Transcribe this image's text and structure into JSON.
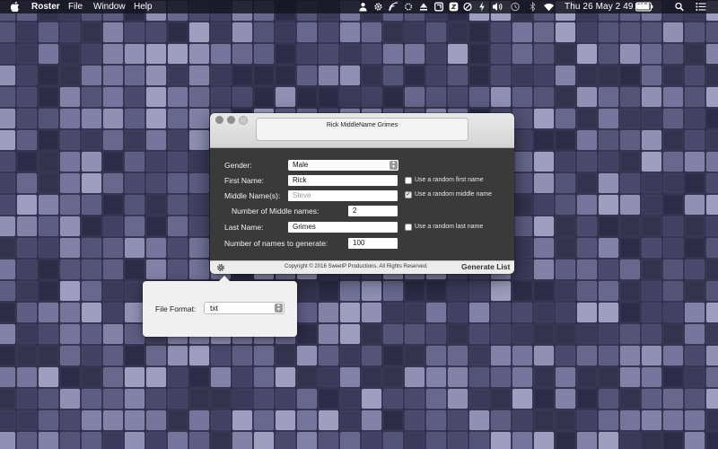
{
  "menubar": {
    "app_name": "Roster",
    "menus": [
      "File",
      "Window",
      "Help"
    ],
    "clock": "Thu 26 May  2 49 PM",
    "status_icons": [
      "user-icon",
      "gear-icon",
      "wifi-cast-icon",
      "sync-icon",
      "eject-icon",
      "app-icon",
      "history-icon",
      "power-icon",
      "volume-icon",
      "time-machine-icon",
      "bluetooth-icon",
      "wifi-icon",
      "battery-icon",
      "spotlight-icon",
      "list-icon"
    ]
  },
  "window": {
    "result": "Rick MiddleName Grimes",
    "gender_label": "Gender:",
    "gender_value": "Male",
    "first_name_label": "First Name:",
    "first_name_value": "Rick",
    "random_first_label": "Use a random first name",
    "random_first_checked": false,
    "middle_label": "Middle Name(s):",
    "middle_placeholder": "Steve",
    "random_middle_label": "Use a random middle name",
    "random_middle_checked": true,
    "num_middle_label": "Number of Middle names:",
    "num_middle_value": "2",
    "last_name_label": "Last Name:",
    "last_name_value": "Grimes",
    "random_last_label": "Use a random last name",
    "random_last_checked": false,
    "num_generate_label": "Number of names to generate:",
    "num_generate_value": "100",
    "copyright": "Copyright © 2016 SweetP Productions. All Rights Reserved.",
    "generate_label": "Generate List"
  },
  "popover": {
    "file_format_label": "File Format:",
    "file_format_value": "txt"
  },
  "colors": {
    "desktop_base": "#3d3c5e",
    "window_body": "#3a3a3a",
    "window_footer": "#ececec"
  }
}
